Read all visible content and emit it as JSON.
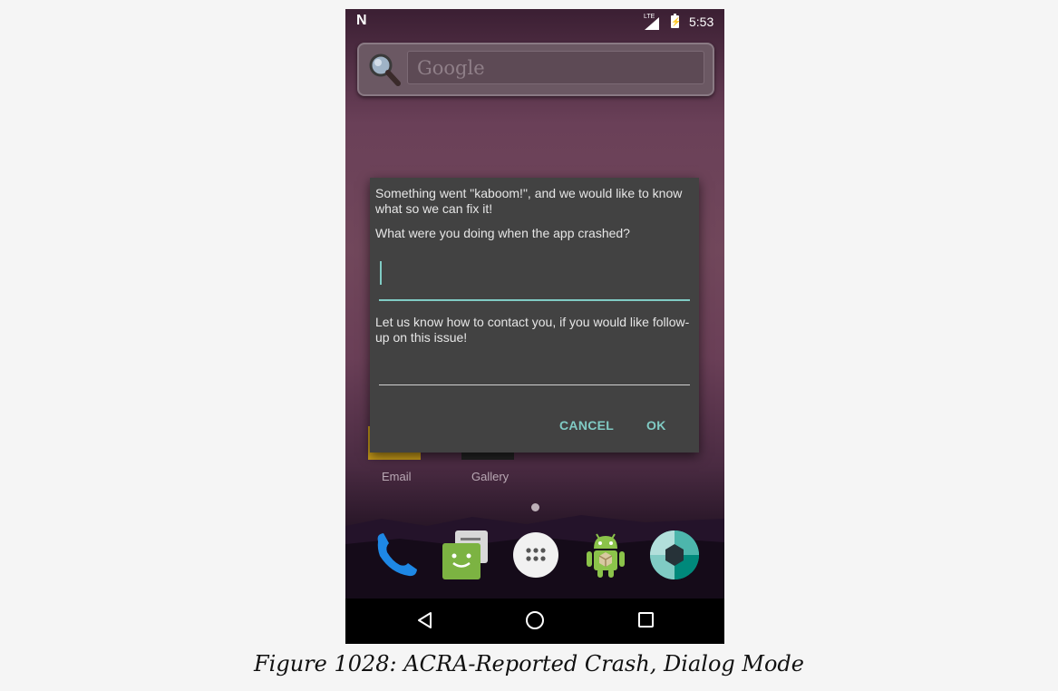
{
  "status_bar": {
    "notification_glyph": "N",
    "network": "LTE",
    "time": "5:53"
  },
  "search_widget": {
    "placeholder": "Google"
  },
  "home_screen": {
    "icons": [
      {
        "label": "Email"
      },
      {
        "label": "Gallery"
      }
    ]
  },
  "dock": {
    "items": [
      "phone-icon",
      "messenger-icon",
      "app-drawer-icon",
      "android-app-icon",
      "camera-icon"
    ]
  },
  "dialog": {
    "message": "Something went \"kaboom!\", and we would like to know what so we can fix it!",
    "comment_prompt": "What were you doing when the app crashed?",
    "comment_value": "",
    "email_prompt": "Let us know how to contact you, if you would like follow-up on this issue!",
    "email_value": "",
    "cancel_label": "CANCEL",
    "ok_label": "OK",
    "accent_color": "#80cbc4"
  },
  "caption": "Figure 1028: ACRA-Reported Crash, Dialog Mode"
}
